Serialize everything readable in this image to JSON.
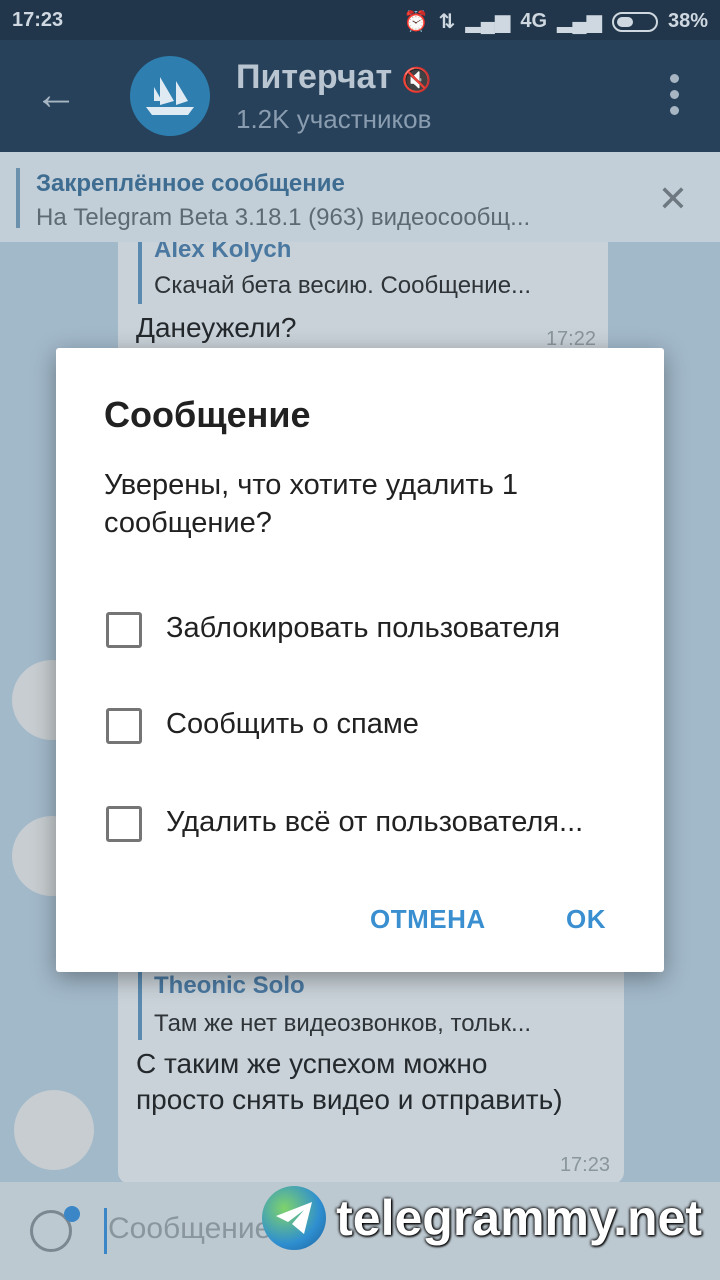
{
  "status_bar": {
    "time": "17:23",
    "network": "4G",
    "battery": "38%"
  },
  "app_bar": {
    "title": "Питерчат",
    "subtitle": "1.2K участников"
  },
  "pinned": {
    "title": "Закреплённое сообщение",
    "text": "На Telegram Beta 3.18.1 (963) видеосообщ..."
  },
  "messages": [
    {
      "reply_name": "Alex Kolych",
      "reply_text": "Скачай бета весию. Сообщение...",
      "text": "Данеужели?",
      "time": "17:22"
    },
    {
      "reply_name": "Theonic Solo",
      "reply_text": "Там же нет видеозвонков, тольк...",
      "text": "С таким же успехом можно просто снять видео и отправить)",
      "time": "17:23"
    }
  ],
  "input": {
    "placeholder": "Сообщение"
  },
  "watermark": "telegrammy.net",
  "dialog": {
    "title": "Сообщение",
    "message": "Уверены, что хотите удалить 1 сообщение?",
    "options": [
      "Заблокировать пользователя",
      "Сообщить о спаме",
      "Удалить всё от пользователя..."
    ],
    "cancel": "ОТМЕНА",
    "ok": "OK"
  },
  "colors": {
    "accent": "#3a8fd0",
    "app_bar": "#264159"
  }
}
